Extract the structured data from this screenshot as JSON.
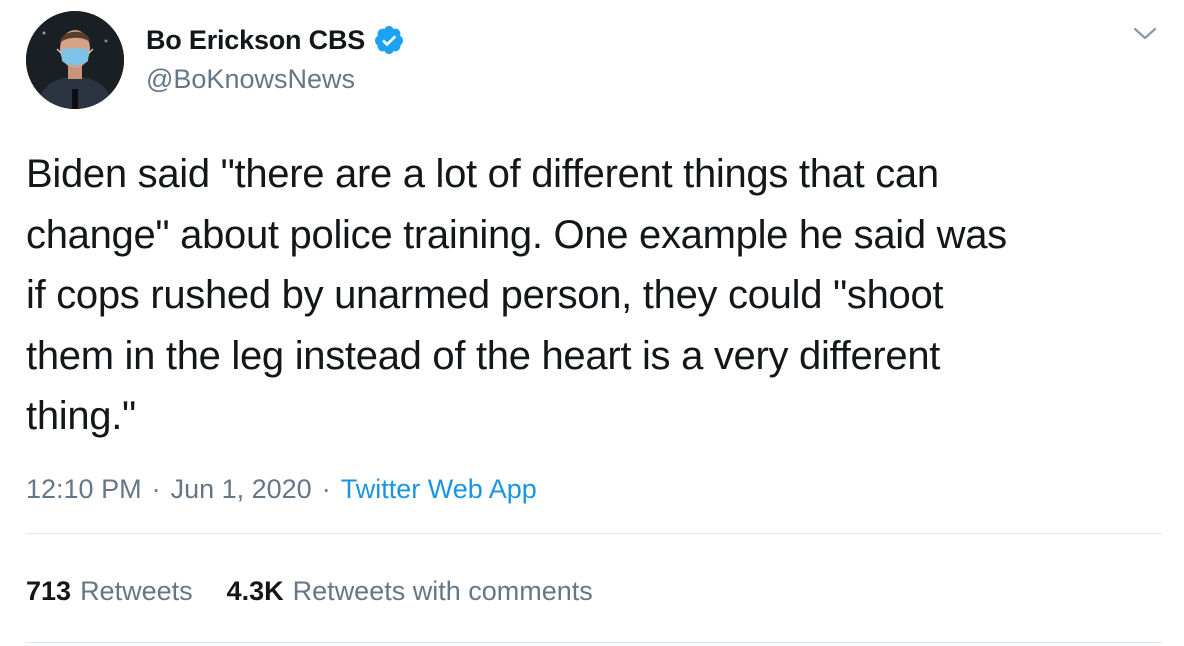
{
  "user": {
    "display_name": "Bo Erickson CBS",
    "handle": "@BoKnowsNews",
    "verified": true,
    "verified_color": "#1da1f2"
  },
  "tweet": {
    "text": "Biden said \"there are a lot of different things that can\nchange\" about police training. One example he said was\nif cops rushed by unarmed person, they could \"shoot\nthem in the leg instead of the heart is a very different\nthing.\"",
    "time": "12:10 PM",
    "separator_1": "·",
    "date": "Jun 1, 2020",
    "separator_2": "·",
    "source": "Twitter Web App"
  },
  "stats": {
    "retweets_count": "713",
    "retweets_label": "Retweets",
    "quote_count": "4.3K",
    "quote_label": "Retweets with comments"
  },
  "icons": {
    "menu": "chevron-down-icon",
    "verified": "verified-badge-icon"
  },
  "colors": {
    "text": "#14171a",
    "secondary": "#657786",
    "link": "#1b95e0",
    "divider": "#e1e8ed"
  }
}
